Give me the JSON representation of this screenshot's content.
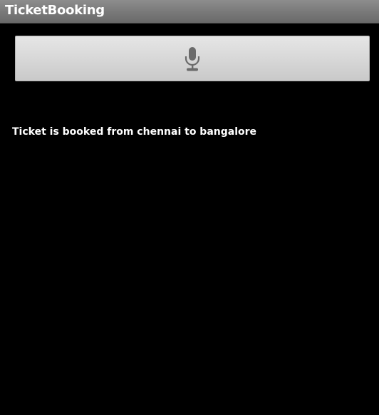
{
  "app": {
    "title": "TicketBooking"
  },
  "voice_input": {
    "icon": "microphone-icon"
  },
  "result": {
    "message": "Ticket is booked from chennai to bangalore"
  },
  "colors": {
    "background": "#000000",
    "title_bar": "#7a7a7a",
    "button": "#d8d8d8",
    "icon": "#6b6b6b",
    "text": "#ffffff"
  }
}
